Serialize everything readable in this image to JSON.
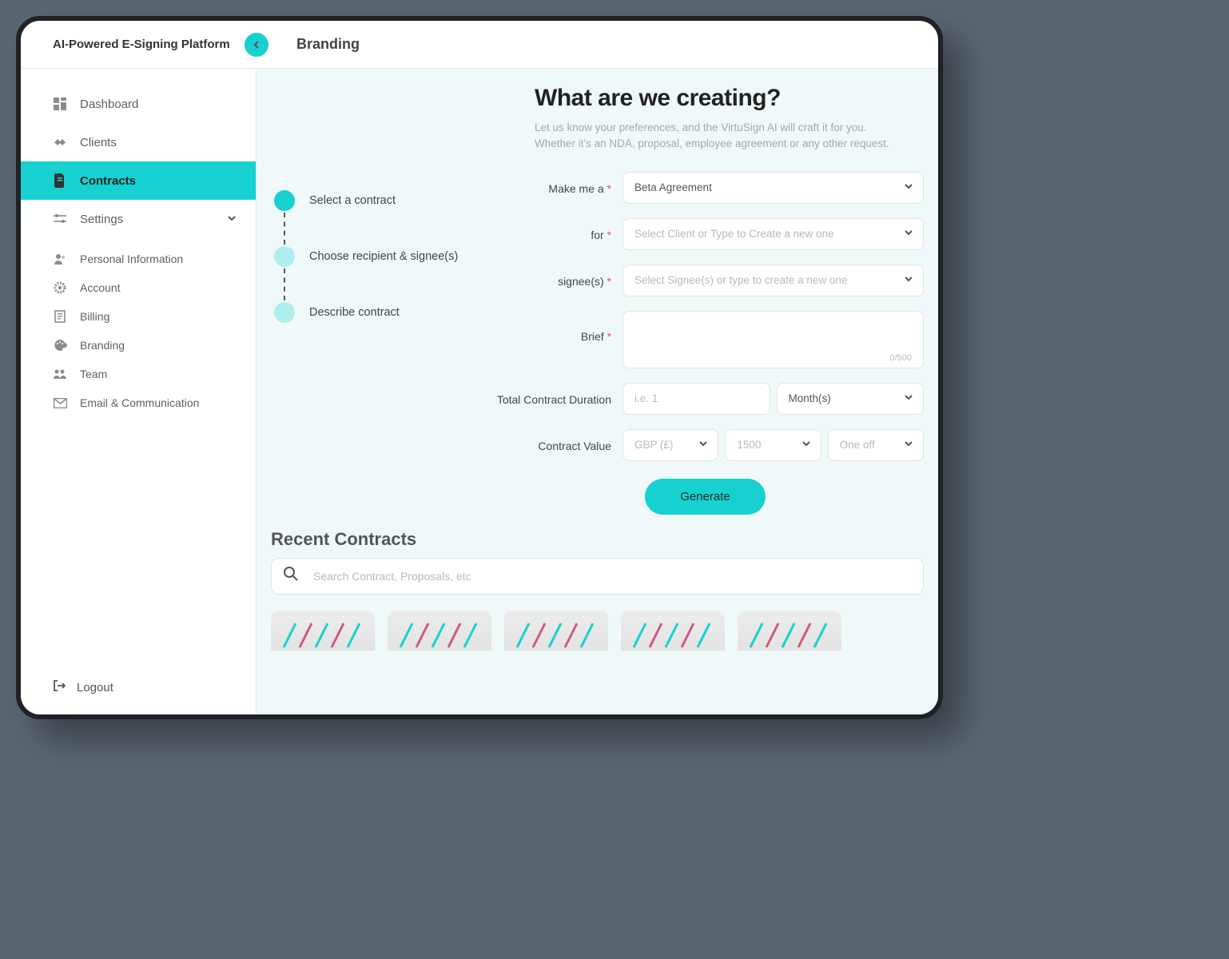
{
  "header": {
    "brand": "AI-Powered E-Signing Platform",
    "page_title": "Branding"
  },
  "sidebar": {
    "items": [
      {
        "label": "Dashboard"
      },
      {
        "label": "Clients"
      },
      {
        "label": "Contracts"
      },
      {
        "label": "Settings"
      }
    ],
    "sub_items": [
      {
        "label": "Personal Information"
      },
      {
        "label": "Account"
      },
      {
        "label": "Billing"
      },
      {
        "label": "Branding"
      },
      {
        "label": "Team"
      },
      {
        "label": "Email & Communication"
      }
    ],
    "logout": "Logout"
  },
  "steps": [
    "Select a contract",
    "Choose recipient & signee(s)",
    "Describe contract"
  ],
  "form": {
    "title": "What are we creating?",
    "sub": "Let us know your preferences, and the VirtuSign AI will craft it for you. Whether it's an NDA, proposal, employee agreement or any other request.",
    "labels": {
      "make": "Make me a",
      "for": "for",
      "signee": "signee(s)",
      "brief": "Brief",
      "duration": "Total Contract Duration",
      "value": "Contract Value"
    },
    "values": {
      "make": "Beta Agreement",
      "for_placeholder": "Select Client or Type to Create a new one",
      "signee_placeholder": "Select Signee(s) or type to create a new one",
      "brief_counter": "0/500",
      "duration_placeholder": "i.e. 1",
      "duration_unit": "Month(s)",
      "currency": "GBP (£)",
      "amount": "1500",
      "frequency": "One off"
    },
    "generate": "Generate"
  },
  "recent": {
    "title": "Recent Contracts",
    "search_placeholder": "Search Contract, Proposals, etc"
  }
}
